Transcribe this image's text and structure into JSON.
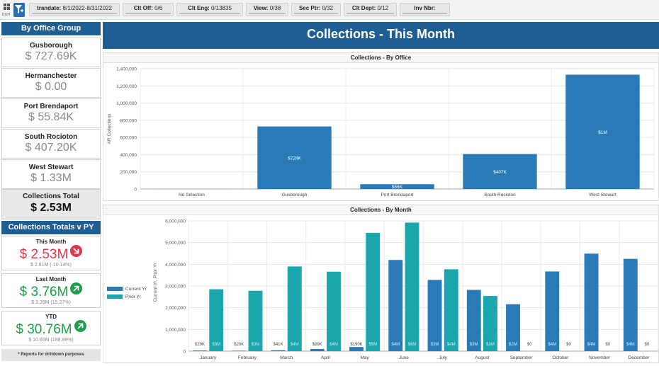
{
  "toolbar": {
    "dsh_label": "DSH",
    "filters": [
      {
        "label": "trandate:",
        "value": "8/1/2022-8/31/2022"
      },
      {
        "label": "Clt Off:",
        "value": "0/6"
      },
      {
        "label": "Clt Eng:",
        "value": "0/13835"
      },
      {
        "label": "View:",
        "value": "0/38"
      },
      {
        "label": "Sec Ptr:",
        "value": "0/32"
      },
      {
        "label": "Clt Dept:",
        "value": "0/12"
      },
      {
        "label": "Inv Nbr:",
        "value": ""
      }
    ]
  },
  "sidebar": {
    "office_header": "By Office Group",
    "offices": [
      {
        "name": "Gusborough",
        "value": "$ 727.69K"
      },
      {
        "name": "Hermanchester",
        "value": "$ 0.00"
      },
      {
        "name": "Port Brendaport",
        "value": "$ 55.84K"
      },
      {
        "name": "South Rocioton",
        "value": "$ 407.20K"
      },
      {
        "name": "West Stewart",
        "value": "$ 1.33M"
      }
    ],
    "total": {
      "name": "Collections Total",
      "value": "$ 2.53M"
    },
    "pv_header": "Collections Totals v PY",
    "periods": [
      {
        "name": "This Month",
        "value": "$ 2.53M",
        "sub": "$ 2.81M (-10.14%)",
        "trend": "down",
        "color": "#e0364f"
      },
      {
        "name": "Last Month",
        "value": "$ 3.76M",
        "sub": "$ 3.26M (15.27%)",
        "trend": "up",
        "color": "#1e9e4a"
      },
      {
        "name": "YTD",
        "value": "$ 30.76M",
        "sub": "$ 10.65M (188.89%)",
        "trend": "up",
        "color": "#1e9e4a"
      }
    ],
    "note": "* Reports for drilldown purposes"
  },
  "banner": {
    "title": "Collections - This Month"
  },
  "chart_data": [
    {
      "type": "bar",
      "title": "Collections - By Office",
      "ylabel": "AR Collections",
      "xlabel": "",
      "ylim": [
        0,
        1400000
      ],
      "yticks": [
        "0",
        "200,000",
        "400,000",
        "600,000",
        "800,000",
        "1,000,000",
        "1,200,000",
        "1,400,000"
      ],
      "categories": [
        "No Selection",
        "Gusborough",
        "Port Brendaport",
        "South Rocioton",
        "West Stewart"
      ],
      "values": [
        0,
        727690,
        55840,
        407200,
        1330000
      ],
      "data_labels": [
        "",
        "$728K",
        "$56K",
        "$407K",
        "$1M"
      ],
      "color": "#2a7ab8",
      "grid": true
    },
    {
      "type": "bar",
      "title": "Collections - By Month",
      "ylabel": "Current Yr, Prior Yr",
      "xlabel": "",
      "ylim": [
        0,
        6000000
      ],
      "yticks": [
        "0",
        "1,000,000",
        "2,000,000",
        "3,000,000",
        "4,000,000",
        "5,000,000",
        "6,000,000"
      ],
      "categories": [
        "January",
        "February",
        "March",
        "April",
        "May",
        "June",
        "July",
        "August",
        "September",
        "October",
        "November",
        "December"
      ],
      "legend_position": "left",
      "grid": true,
      "series": [
        {
          "name": "Current Yr",
          "color": "#2a7ab8",
          "values": [
            29000,
            20000,
            41000,
            99000,
            190000,
            4200000,
            3280000,
            2820000,
            2160000,
            3670000,
            4490000,
            4250000
          ],
          "data_labels": [
            "$29K",
            "$20K",
            "$41K",
            "$99K",
            "$190K",
            "$4M",
            "$3M",
            "$3M",
            "$2M",
            "$4M",
            "$4M",
            "$4M"
          ]
        },
        {
          "name": "Prior Yr",
          "color": "#1ba6ad",
          "values": [
            2850000,
            2780000,
            3900000,
            3660000,
            5450000,
            5920000,
            3770000,
            2540000,
            0,
            0,
            0,
            0
          ],
          "data_labels": [
            "$3M",
            "$3M",
            "$4M",
            "$4M",
            "$5M",
            "$6M",
            "$4M",
            "$3M",
            "$0",
            "$0",
            "$0",
            "$0"
          ]
        }
      ]
    }
  ]
}
